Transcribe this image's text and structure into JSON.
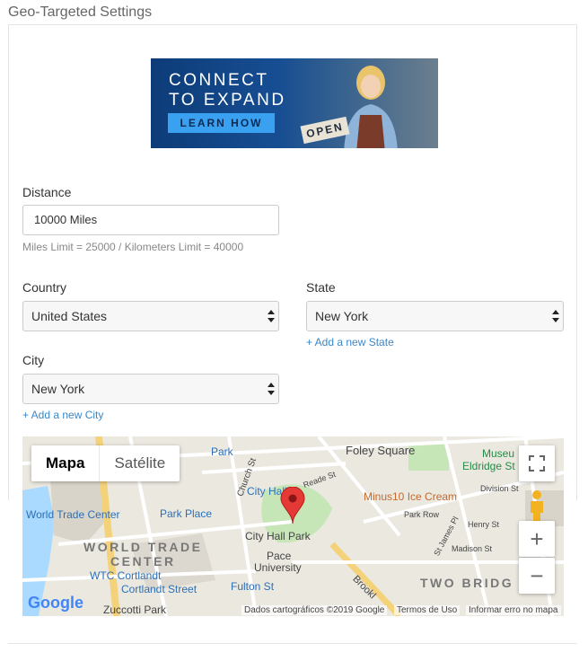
{
  "section": {
    "title": "Geo-Targeted Settings"
  },
  "banner": {
    "headline_line1": "CONNECT",
    "headline_line2": "TO EXPAND",
    "cta": "LEARN HOW",
    "sign": "OPEN"
  },
  "distance": {
    "label": "Distance",
    "value": "10000 Miles",
    "help": "Miles Limit = 25000 / Kilometers Limit = 40000"
  },
  "country": {
    "label": "Country",
    "selected": "United States"
  },
  "state": {
    "label": "State",
    "selected": "New York",
    "add_link": "+ Add a new State"
  },
  "city": {
    "label": "City",
    "selected": "New York",
    "add_link": "+ Add a new City"
  },
  "map": {
    "type_map": "Mapa",
    "type_satellite": "Satélite",
    "zoom_in": "+",
    "zoom_out": "−",
    "logo": "Google",
    "footer_data": "Dados cartográficos ©2019 Google",
    "footer_terms": "Termos de Uso",
    "footer_report": "Informar erro no mapa",
    "labels": {
      "foley": "Foley Square",
      "museum": "Museu",
      "eldridge": "Eldridge St",
      "park_top": "Park",
      "church": "Church St",
      "city_hall_station": "City Hall",
      "reade": "Reade St",
      "minus10": "Minus10 Ice Cream",
      "division": "Division St",
      "wtc": "World Trade Center",
      "park_place": "Park Place",
      "city_hall_park": "City Hall Park",
      "park_row": "Park Row",
      "henry": "Henry St",
      "world_trade": "WORLD TRADE",
      "center": "CENTER",
      "st_james": "St James Pl",
      "madison": "Madison St",
      "pace1": "Pace",
      "pace2": "University",
      "wtc_cortlandt": "WTC Cortlandt",
      "cortlandt": "Cortlandt Street",
      "fulton": "Fulton St",
      "two_bridges": "TWO BRIDG",
      "brooklyn": "Brookl",
      "zuccotti": "Zuccotti Park"
    }
  },
  "colors": {
    "accent_link": "#3a87c8",
    "banner_blue": "#0d3c78",
    "cta_blue": "#3aa0f0",
    "map_pin": "#e53935"
  }
}
